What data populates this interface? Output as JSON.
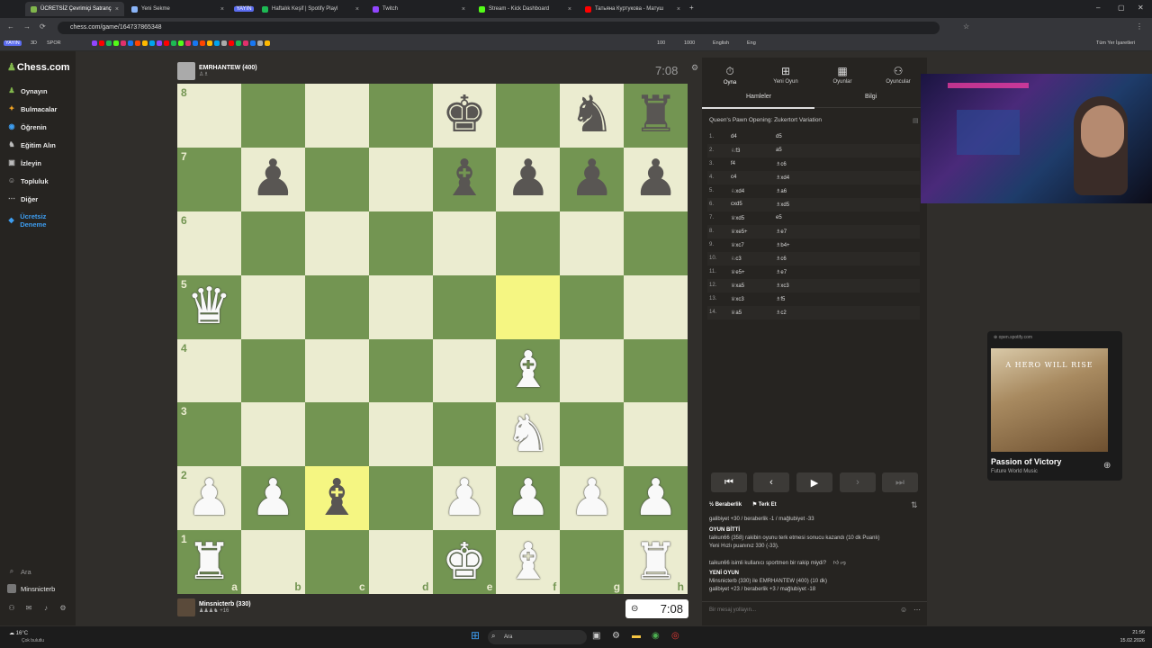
{
  "browser": {
    "tabs": [
      {
        "label": "ÜCRETSİZ Çevrimiçi Satranç",
        "color": "#81b64c",
        "active": true
      },
      {
        "label": "Yeni Sekme",
        "color": "#8ab4f8"
      },
      {
        "label": "Haftalık Keşif | Spotify Playl",
        "color": "#1db954"
      },
      {
        "label": "Twitch",
        "color": "#9146ff"
      },
      {
        "label": "Stream - Kick Dashboard",
        "color": "#53fc18"
      },
      {
        "label": "Татьяна Куртукова - Матуш",
        "color": "#ff0000"
      }
    ],
    "live_badge": "YAYIN",
    "url": "chess.com/game/164737865348",
    "bookmarks": [
      "YAYIN",
      "3D",
      "SPOR",
      "100",
      "1000",
      "English",
      "Eng",
      "Tüm Yer İşaretleri"
    ]
  },
  "sidebar": {
    "logo": "Chess.com",
    "items": [
      {
        "label": "Oynayın",
        "icon": "play-icon"
      },
      {
        "label": "Bulmacalar",
        "icon": "puzzle-icon"
      },
      {
        "label": "Öğrenin",
        "icon": "learn-icon"
      },
      {
        "label": "Eğitim Alın",
        "icon": "train-icon"
      },
      {
        "label": "İzleyin",
        "icon": "watch-icon"
      },
      {
        "label": "Topluluk",
        "icon": "community-icon"
      },
      {
        "label": "Diğer",
        "icon": "more-icon"
      },
      {
        "label": "Ücretsiz Deneme",
        "icon": "diamond-icon"
      }
    ],
    "search": "Ara",
    "user": "Minsnicterb"
  },
  "game": {
    "top_player": {
      "name": "EMRHANTEW (400)",
      "clock": "7:08"
    },
    "bottom_player": {
      "name": "Minsnicterb (330)",
      "sub": "+16",
      "clock": "7:08"
    },
    "files": [
      "a",
      "b",
      "c",
      "d",
      "e",
      "f",
      "g",
      "h"
    ],
    "ranks": [
      "8",
      "7",
      "6",
      "5",
      "4",
      "3",
      "2",
      "1"
    ],
    "position": [
      [
        "",
        "",
        "",
        "",
        "bk",
        "",
        "bn",
        "br"
      ],
      [
        "",
        "bp",
        "",
        "",
        "bb",
        "bp",
        "bp",
        "bp"
      ],
      [
        "",
        "",
        "",
        "",
        "",
        "",
        "",
        ""
      ],
      [
        "wq",
        "",
        "",
        "",
        "",
        "",
        "",
        ""
      ],
      [
        "",
        "",
        "",
        "",
        "",
        "wb",
        "",
        ""
      ],
      [
        "",
        "",
        "",
        "",
        "",
        "wn",
        "",
        ""
      ],
      [
        "wp",
        "wp",
        "bb",
        "",
        "wp",
        "wp",
        "wp",
        "wp"
      ],
      [
        "wr",
        "",
        "",
        "",
        "wk",
        "wb",
        "",
        "wr"
      ]
    ],
    "highlights": [
      "f5",
      "c2"
    ]
  },
  "panel": {
    "tabs": [
      {
        "label": "Oyna",
        "icon": "clock-icon"
      },
      {
        "label": "Yeni Oyun",
        "icon": "plus-icon"
      },
      {
        "label": "Oyunlar",
        "icon": "grid-icon"
      },
      {
        "label": "Oyuncular",
        "icon": "players-icon"
      }
    ],
    "subtabs": [
      "Hamleler",
      "Bilgi"
    ],
    "opening": "Queen's Pawn Opening: Zukertort Variation",
    "moves": [
      {
        "n": "1.",
        "w": "d4",
        "b": "d5"
      },
      {
        "n": "2.",
        "w": "♘f3",
        "b": "a5"
      },
      {
        "n": "3.",
        "w": "f4",
        "b": "♗c6"
      },
      {
        "n": "4.",
        "w": "c4",
        "b": "♗xd4"
      },
      {
        "n": "5.",
        "w": "♘xd4",
        "b": "♗a6"
      },
      {
        "n": "6.",
        "w": "cxd5",
        "b": "♗xd5"
      },
      {
        "n": "7.",
        "w": "♕xd5",
        "b": "e5"
      },
      {
        "n": "8.",
        "w": "♕xe5+",
        "b": "♗e7"
      },
      {
        "n": "9.",
        "w": "♕xc7",
        "b": "♗b4+"
      },
      {
        "n": "10.",
        "w": "♘c3",
        "b": "♗c6"
      },
      {
        "n": "11.",
        "w": "♕e5+",
        "b": "♗e7"
      },
      {
        "n": "12.",
        "w": "♕xa5",
        "b": "♗xc3"
      },
      {
        "n": "13.",
        "w": "♕xc3",
        "b": "♗f5"
      },
      {
        "n": "14.",
        "w": "♕a5",
        "b": "♗c2"
      }
    ],
    "draw_label": "Beraberlik",
    "resign_label": "Terk Et",
    "stats_line": "galibiyet +30 / beraberlik -1 / mağlubiyet -33",
    "game_over": "OYUN BİTTİ",
    "result_line": "taikun66 (358) rakibin oyunu terk etmesi sonucu kazandı (10 dk Puanlı)",
    "rating_line": "Yeni Hızlı puanınız 330 (-33).",
    "sportsman_q": "taikun66 isimli kullanıcı sportmen bir rakip miydi?",
    "new_game": "YENİ OYUN",
    "new_game_line": "Minsnicterb (330) ile EMRHANTEW (400) (10 dk)",
    "new_stats_line": "galibiyet +23 / beraberlik +3 / mağlubiyet -18",
    "chat_placeholder": "Bir mesaj yollayın..."
  },
  "spotify": {
    "source": "open.spotify.com",
    "art_text": "A HERO WILL RISE",
    "title": "Passion of Victory",
    "artist": "Future World Music"
  },
  "taskbar": {
    "weather": "16°C",
    "weather_sub": "Çok bulutlu",
    "search": "Ara",
    "time": "21:56",
    "date": "15.02.2026"
  }
}
